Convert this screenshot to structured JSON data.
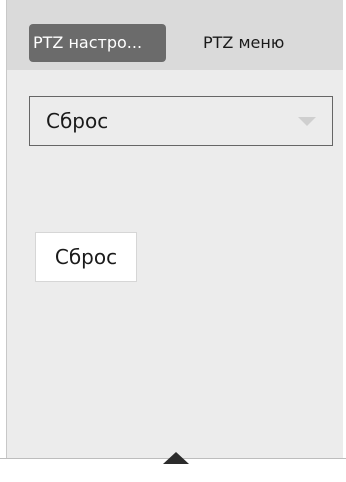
{
  "tabs": [
    {
      "label": "PTZ настро...",
      "active": true
    },
    {
      "label": "PTZ меню",
      "active": false
    }
  ],
  "preset_select": {
    "selected_value": "Сброс"
  },
  "action_button": {
    "label": "Сброс"
  },
  "icons": {
    "dropdown": "chevron-down-icon",
    "collapse": "collapse-up-icon"
  },
  "colors": {
    "active_tab": "#6b6b6b",
    "tabbar": "#dadada",
    "panel": "#ececec"
  }
}
